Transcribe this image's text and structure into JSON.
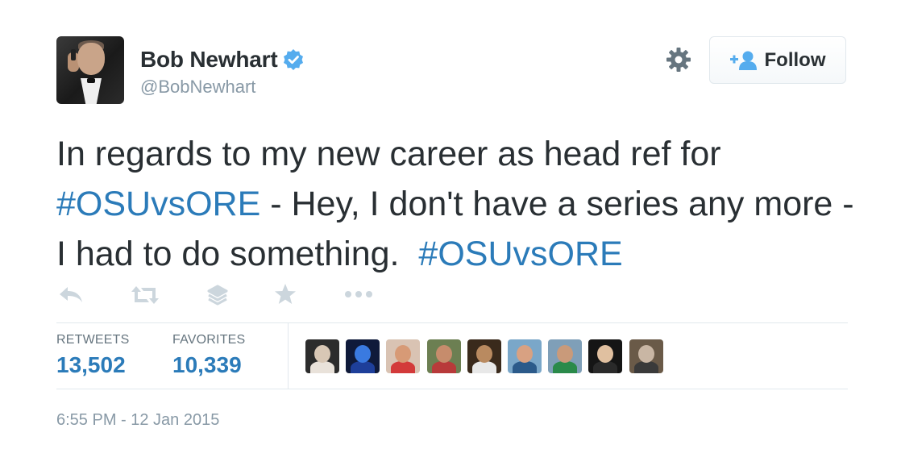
{
  "author": {
    "name": "Bob Newhart",
    "handle": "@BobNewhart",
    "verified": true,
    "avatar_icon": "profile-photo"
  },
  "follow_button": {
    "label": "Follow",
    "icon": "follow-person-plus-icon"
  },
  "settings_icon": "gear-icon",
  "tweet": {
    "segments": [
      {
        "text": "In regards to my new career as head ref for ",
        "type": "text"
      },
      {
        "text": "#OSUvsORE",
        "type": "hashtag"
      },
      {
        "text": " - Hey, I don't have a series any more - I had to do something.  ",
        "type": "text"
      },
      {
        "text": "#OSUvsORE",
        "type": "hashtag"
      }
    ]
  },
  "actions": [
    {
      "name": "reply",
      "icon": "reply-icon"
    },
    {
      "name": "retweet",
      "icon": "retweet-icon"
    },
    {
      "name": "buffer",
      "icon": "layers-icon"
    },
    {
      "name": "favorite",
      "icon": "star-icon"
    },
    {
      "name": "more",
      "icon": "more-dots-icon"
    }
  ],
  "stats": {
    "retweets_label": "RETWEETS",
    "retweets_value": "13,502",
    "favorites_label": "FAVORITES",
    "favorites_value": "10,339"
  },
  "favoriters": [
    {
      "bg": "#2c2c2c",
      "head": "#d8c7b5",
      "body": "#e9e2da"
    },
    {
      "bg": "#0f1a3a",
      "head": "#3a7ae0",
      "body": "#1e3f9a"
    },
    {
      "bg": "#d9c3b3",
      "head": "#d79a76",
      "body": "#d33a3a"
    },
    {
      "bg": "#6c7f52",
      "head": "#c68c6c",
      "body": "#b83a3a"
    },
    {
      "bg": "#3a2a1c",
      "head": "#b98a60",
      "body": "#e8e8e8"
    },
    {
      "bg": "#7aa7c9",
      "head": "#d8a182",
      "body": "#2b5a8a"
    },
    {
      "bg": "#7f9fb8",
      "head": "#c99a7a",
      "body": "#2a8a4a"
    },
    {
      "bg": "#151515",
      "head": "#e0c0a0",
      "body": "#2a2a2a"
    },
    {
      "bg": "#6a5a48",
      "head": "#c9b6a4",
      "body": "#3a3a3a"
    }
  ],
  "timestamp": "6:55 PM - 12 Jan 2015",
  "colors": {
    "link": "#2b7bb9",
    "text": "#292f33",
    "muted": "#8899a6",
    "icon": "#ccd6dd",
    "verified": "#55acee"
  }
}
